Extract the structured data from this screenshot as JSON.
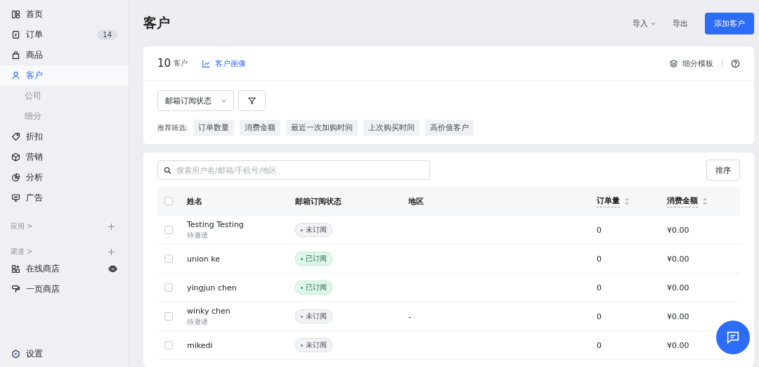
{
  "sidebar": {
    "items": [
      {
        "label": "首页",
        "selected": false
      },
      {
        "label": "订单",
        "badge": "14",
        "selected": false
      },
      {
        "label": "商品",
        "selected": false
      },
      {
        "label": "客户",
        "selected": true,
        "children": [
          {
            "label": "公司",
            "selected": false
          },
          {
            "label": "细分",
            "selected": false
          }
        ]
      },
      {
        "label": "折扣",
        "selected": false
      },
      {
        "label": "营销",
        "selected": false
      },
      {
        "label": "分析",
        "selected": false
      },
      {
        "label": "广告",
        "selected": false
      }
    ],
    "sections": [
      {
        "label": "应用 >"
      },
      {
        "label": "渠道 >",
        "items": [
          {
            "label": "在线商店",
            "visible": true
          },
          {
            "label": "一页商店",
            "visible": false
          }
        ]
      }
    ],
    "footer": {
      "label": "设置"
    }
  },
  "header": {
    "title": "客户",
    "actions": [
      {
        "label": "导入",
        "dropdown": true
      },
      {
        "label": "导出",
        "dropdown": false
      }
    ],
    "primary": "添加客户"
  },
  "summary": {
    "count": "10",
    "unit": "客户",
    "link": "客户画像",
    "template": "细分模板",
    "filter": "邮箱订阅状态",
    "recommend_label": "推荐筛选:",
    "chips": [
      "订单数量",
      "消费金额",
      "最近一次加购时间",
      "上次购买时间",
      "高价值客户"
    ]
  },
  "table": {
    "select_all_checked": false,
    "search": {
      "placeholder": "搜索用户名/邮箱/手机号/地区"
    },
    "sort_button": "排序",
    "columns": [
      {
        "label": "姓名",
        "sortable": false
      },
      {
        "label": "邮箱订阅状态",
        "sortable": false
      },
      {
        "label": "地区",
        "sortable": false
      },
      {
        "label": "订单量",
        "sortable": true
      },
      {
        "label": "消费金额",
        "sortable": true
      }
    ],
    "rows": [
      {
        "name": "Testing Testing",
        "note": "待邀请",
        "status": "未订阅",
        "subscribed": false,
        "orders": "0",
        "amount": "¥0.00",
        "checked": false
      },
      {
        "name": "union ke",
        "status": "已订阅",
        "subscribed": true,
        "orders": "0",
        "amount": "¥0.00",
        "checked": false
      },
      {
        "name": "yingjun chen",
        "status": "已订阅",
        "subscribed": true,
        "orders": "0",
        "amount": "¥0.00",
        "checked": false
      },
      {
        "name": "winky chen",
        "note": "待邀请",
        "status": "未订阅",
        "subscribed": false,
        "region": "-",
        "orders": "0",
        "amount": "¥0.00",
        "checked": false
      },
      {
        "name": "mikedi",
        "status": "未订阅",
        "subscribed": false,
        "orders": "0",
        "amount": "¥0.00",
        "checked": false
      }
    ]
  }
}
